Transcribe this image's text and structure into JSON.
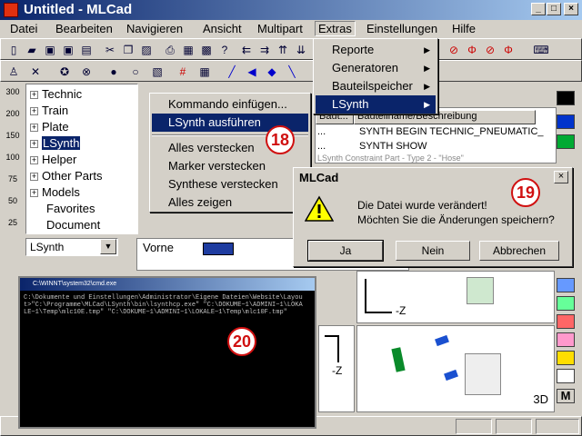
{
  "window": {
    "title": "Untitled - MLCad",
    "min": "_",
    "max": "□",
    "close": "×"
  },
  "menubar": [
    "Datei",
    "Bearbeiten",
    "Navigieren",
    "Ansicht",
    "Multipart",
    "Extras",
    "Einstellungen",
    "Hilfe"
  ],
  "extras_menu": {
    "items": [
      {
        "label": "Reporte",
        "has_submenu": true
      },
      {
        "label": "Generatoren",
        "has_submenu": true
      },
      {
        "label": "Bauteilspeicher",
        "has_submenu": true
      },
      {
        "label": "LSynth",
        "has_submenu": true,
        "selected": true
      }
    ]
  },
  "lsynth_menu": {
    "items": [
      {
        "label": "Kommando einfügen..."
      },
      {
        "label": "LSynth ausführen",
        "selected": true
      },
      {
        "label": "Alles verstecken"
      },
      {
        "label": "Marker verstecken"
      },
      {
        "label": "Synthese verstecken"
      },
      {
        "label": "Alles zeigen"
      }
    ]
  },
  "tree": {
    "items": [
      {
        "label": "Technic",
        "expandable": true
      },
      {
        "label": "Train",
        "expandable": true
      },
      {
        "label": "Plate",
        "expandable": true
      },
      {
        "label": "LSynth",
        "expandable": true,
        "selected": true
      },
      {
        "label": "Helper",
        "expandable": true
      },
      {
        "label": "Other Parts",
        "expandable": true
      },
      {
        "label": "Models",
        "expandable": true
      },
      {
        "label": "Favorites",
        "expandable": false
      },
      {
        "label": "Document",
        "expandable": false
      }
    ]
  },
  "zoom_levels": [
    "300",
    "200",
    "150",
    "100",
    "75",
    "50",
    "25"
  ],
  "part_filter": {
    "value": "LSynth"
  },
  "view_front": {
    "label": "Vorne"
  },
  "parts_list": {
    "col_part": "Baut...",
    "col_desc": "Bauteilname/Beschreibung",
    "rows": [
      {
        "part": "...",
        "desc": "SYNTH BEGIN TECHNIC_PNEUMATIC_"
      },
      {
        "part": "...",
        "desc": "SYNTH SHOW"
      },
      {
        "part": "LSynth Constraint Part - Type 2 - \"Hose\"",
        "desc": ""
      }
    ]
  },
  "dialog": {
    "title": "MLCad",
    "message1": "Die Datei wurde verändert!",
    "message2": "Möchten Sie die Änderungen speichern?",
    "btn_yes": "Ja",
    "btn_no": "Nein",
    "btn_cancel": "Abbrechen"
  },
  "console": {
    "title": "C:\\WINNT\\system32\\cmd.exe",
    "text": "C:\\Dokumente und Einstellungen\\Administrator\\Eigene Dateien\\Website\\Layout>\"C:\\Programme\\MLCad\\LSynth\\bin\\lsynthcp.exe\" \"C:\\DOKUME~1\\ADMINI~1\\LOKALE~1\\Temp\\mlc10E.tmp\" \"C:\\DOKUME~1\\ADMINI~1\\LOKALE~1\\Temp\\mlc10F.tmp\""
  },
  "badges": {
    "b18": "18",
    "b19": "19",
    "b20": "20"
  },
  "axis_labels": {
    "neg_z_1": "-Z",
    "neg_z_2": "-Z",
    "view_3d": "3D"
  },
  "palette_colors": [
    "#000000",
    "#0033cc",
    "#00aa33",
    "#cc0000",
    "#6699ff",
    "#66ff99",
    "#ff6666",
    "#ff99cc",
    "#ffdd00",
    "#ffffff"
  ],
  "palette_m": "M"
}
